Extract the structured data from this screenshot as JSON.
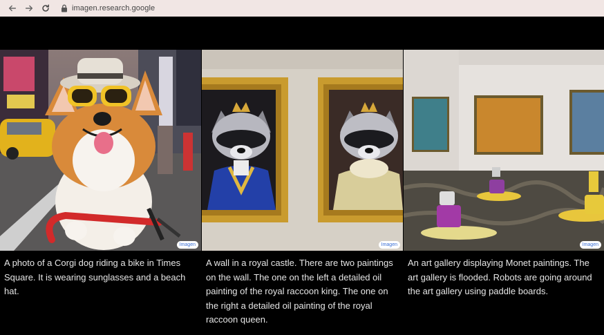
{
  "browser": {
    "url": "imagen.research.google",
    "back_icon": "arrow-left-icon",
    "forward_icon": "arrow-right-icon",
    "reload_icon": "reload-icon",
    "lock_icon": "lock-icon"
  },
  "gallery": {
    "badge_label": "Imagen",
    "items": [
      {
        "caption": "A photo of a Corgi dog riding a bike in Times Square. It is wearing sunglasses and a beach hat."
      },
      {
        "caption": "A wall in a royal castle. There are two paintings on the wall. The one on the left a detailed oil painting of the royal raccoon king. The one on the right a detailed oil painting of the royal raccoon queen."
      },
      {
        "caption": "An art gallery displaying Monet paintings. The art gallery is flooded. Robots are going around the art gallery using paddle boards."
      }
    ]
  },
  "colors": {
    "browser_bar": "#f1e6e4",
    "page_background": "#000000",
    "caption_text": "#e6e6e6",
    "badge_text": "#3a6fd6"
  }
}
